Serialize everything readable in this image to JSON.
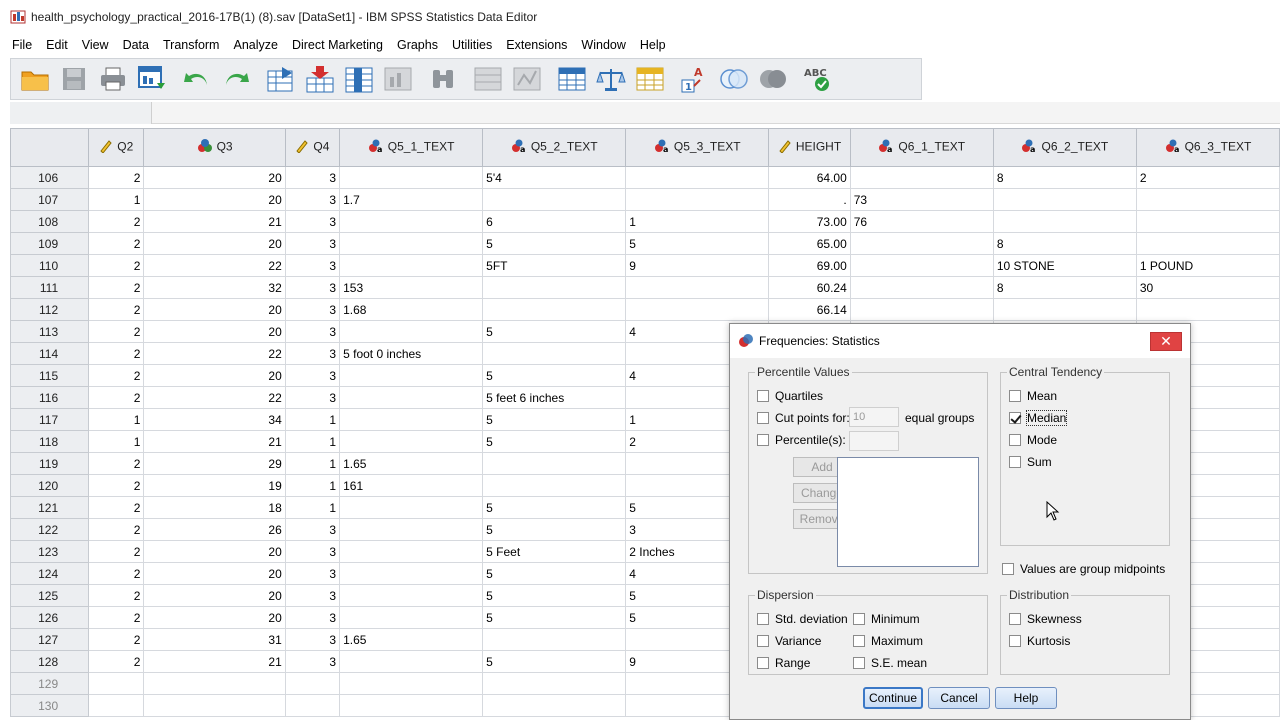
{
  "window": {
    "title": "health_psychology_practical_2016-17B(1) (8).sav [DataSet1] - IBM SPSS Statistics Data Editor"
  },
  "menu": [
    "File",
    "Edit",
    "View",
    "Data",
    "Transform",
    "Analyze",
    "Direct Marketing",
    "Graphs",
    "Utilities",
    "Extensions",
    "Window",
    "Help"
  ],
  "grid": {
    "columns": [
      {
        "name": "Q2",
        "icon": "scale-ruler-icon"
      },
      {
        "name": "Q3",
        "icon": "nominal-circles-icon"
      },
      {
        "name": "Q4",
        "icon": "scale-ruler-icon"
      },
      {
        "name": "Q5_1_TEXT",
        "icon": "string-nominal-icon"
      },
      {
        "name": "Q5_2_TEXT",
        "icon": "string-nominal-icon"
      },
      {
        "name": "Q5_3_TEXT",
        "icon": "string-nominal-icon"
      },
      {
        "name": "HEIGHT",
        "icon": "scale-ruler-icon"
      },
      {
        "name": "Q6_1_TEXT",
        "icon": "string-nominal-icon"
      },
      {
        "name": "Q6_2_TEXT",
        "icon": "string-nominal-icon"
      },
      {
        "name": "Q6_3_TEXT",
        "icon": "string-nominal-icon"
      }
    ],
    "rows": [
      {
        "n": "106",
        "c": [
          "2",
          "20",
          "3",
          "",
          "5'4",
          "",
          "64.00",
          "",
          "8",
          "2"
        ]
      },
      {
        "n": "107",
        "c": [
          "1",
          "20",
          "3",
          "1.7",
          "",
          "",
          ".",
          "73",
          "",
          ""
        ]
      },
      {
        "n": "108",
        "c": [
          "2",
          "21",
          "3",
          "",
          "6",
          "1",
          "73.00",
          "76",
          "",
          ""
        ]
      },
      {
        "n": "109",
        "c": [
          "2",
          "20",
          "3",
          "",
          "5",
          "5",
          "65.00",
          "",
          "8",
          ""
        ]
      },
      {
        "n": "110",
        "c": [
          "2",
          "22",
          "3",
          "",
          "5FT",
          "9",
          "69.00",
          "",
          "10 STONE",
          "1 POUND"
        ]
      },
      {
        "n": "111",
        "c": [
          "2",
          "32",
          "3",
          "153",
          "",
          "",
          "60.24",
          "",
          "8",
          "30"
        ]
      },
      {
        "n": "112",
        "c": [
          "2",
          "20",
          "3",
          "1.68",
          "",
          "",
          "66.14",
          "",
          "",
          ""
        ]
      },
      {
        "n": "113",
        "c": [
          "2",
          "20",
          "3",
          "",
          "5",
          "4",
          "",
          "",
          "",
          ""
        ]
      },
      {
        "n": "114",
        "c": [
          "2",
          "22",
          "3",
          "5 foot 0 inches",
          "",
          "",
          "",
          "",
          "",
          ""
        ]
      },
      {
        "n": "115",
        "c": [
          "2",
          "20",
          "3",
          "",
          "5",
          "4",
          "",
          "",
          "",
          ""
        ]
      },
      {
        "n": "116",
        "c": [
          "2",
          "22",
          "3",
          "",
          "5 feet 6 inches",
          "",
          "",
          "",
          "",
          ""
        ]
      },
      {
        "n": "117",
        "c": [
          "1",
          "34",
          "1",
          "",
          "5",
          "1",
          "",
          "",
          "",
          ""
        ]
      },
      {
        "n": "118",
        "c": [
          "1",
          "21",
          "1",
          "",
          "5",
          "2",
          "",
          "",
          "",
          ""
        ]
      },
      {
        "n": "119",
        "c": [
          "2",
          "29",
          "1",
          "1.65",
          "",
          "",
          "",
          "",
          "",
          ""
        ]
      },
      {
        "n": "120",
        "c": [
          "2",
          "19",
          "1",
          "161",
          "",
          "",
          "",
          "",
          "",
          ""
        ]
      },
      {
        "n": "121",
        "c": [
          "2",
          "18",
          "1",
          "",
          "5",
          "5",
          "",
          "",
          "",
          ""
        ]
      },
      {
        "n": "122",
        "c": [
          "2",
          "26",
          "3",
          "",
          "5",
          "3",
          "",
          "",
          "",
          ""
        ]
      },
      {
        "n": "123",
        "c": [
          "2",
          "20",
          "3",
          "",
          "5 Feet",
          "2 Inches",
          "",
          "",
          "",
          ""
        ]
      },
      {
        "n": "124",
        "c": [
          "2",
          "20",
          "3",
          "",
          "5",
          "4",
          "",
          "",
          "",
          ""
        ]
      },
      {
        "n": "125",
        "c": [
          "2",
          "20",
          "3",
          "",
          "5",
          "5",
          "",
          "",
          "",
          ""
        ]
      },
      {
        "n": "126",
        "c": [
          "2",
          "20",
          "3",
          "",
          "5",
          "5",
          "",
          "",
          "",
          ""
        ]
      },
      {
        "n": "127",
        "c": [
          "2",
          "31",
          "3",
          "1.65",
          "",
          "",
          "",
          "",
          "",
          ""
        ]
      },
      {
        "n": "128",
        "c": [
          "2",
          "21",
          "3",
          "",
          "5",
          "9",
          "",
          "",
          "",
          ""
        ]
      },
      {
        "n": "129",
        "c": [
          "",
          "",
          "",
          "",
          "",
          "",
          "",
          "",
          "",
          ""
        ]
      },
      {
        "n": "130",
        "c": [
          "",
          "",
          "",
          "",
          "",
          "",
          "",
          "",
          "",
          ""
        ]
      }
    ]
  },
  "dialog": {
    "title": "Frequencies: Statistics",
    "close": "✕",
    "percentile": {
      "label": "Percentile Values",
      "quartiles": "Quartiles",
      "cut_points": "Cut points for:",
      "cut_value": "10",
      "equal_groups": "equal groups",
      "percentiles": "Percentile(s):",
      "add": "Add",
      "change": "Change",
      "remove": "Remove"
    },
    "central": {
      "label": "Central Tendency",
      "mean": "Mean",
      "median": "Median",
      "mode": "Mode",
      "sum": "Sum"
    },
    "midpoints": "Values are group midpoints",
    "dispersion": {
      "label": "Dispersion",
      "std": "Std. deviation",
      "minimum": "Minimum",
      "variance": "Variance",
      "maximum": "Maximum",
      "range": "Range",
      "se_mean": "S.E. mean"
    },
    "distribution": {
      "label": "Distribution",
      "skewness": "Skewness",
      "kurtosis": "Kurtosis"
    },
    "buttons": {
      "continue": "Continue",
      "cancel": "Cancel",
      "help": "Help"
    }
  },
  "colors": {
    "header_bg": "#e8eaee",
    "toolbar_bg": "#eceef1",
    "close_red": "#e04343",
    "accent_blue": "#3b78c6"
  }
}
